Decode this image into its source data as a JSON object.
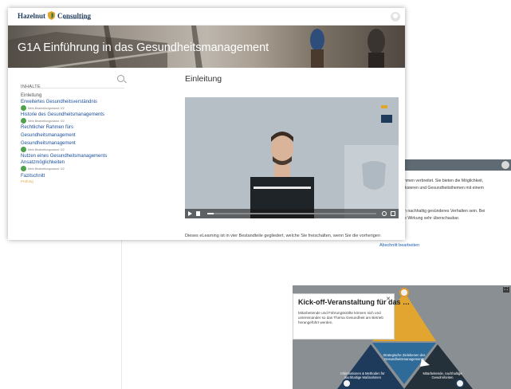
{
  "background_page": {
    "lines": [
      "nmen verbreitet. Sie bieten die Möglichkeit,",
      "iksieren und Gesundheitsthemen mit einem",
      "n nachhaltig gesünderes Verhalten sein. Bei",
      "e Wirkung sehr überschaubar."
    ],
    "edit_link": "Abschnitt bearbeiten"
  },
  "infographic": {
    "popup_title": "Kick-off-Veranstaltung für das …",
    "popup_body": "Mitarbeitende und Führungskräfte können sich und untereinander so das Thema Gesundheit am Betrieb herangeführt werden.",
    "center_label": "Strategische Zielebenen des Gesundheitsmanagements",
    "left_label": "Informationen & Methoden für nachhaltige Maßnahmen",
    "right_label": "Mitarbeitende, nachhaltige Gewohnheiten",
    "corner": "⛶",
    "colors": {
      "top": "#e2a52f",
      "center": "#2f6b99",
      "left": "#1f3b5c",
      "right": "#24303a"
    }
  },
  "card": {
    "logo_left": "Hazelnut",
    "logo_right": "Consulting",
    "logo_sub": "Gesundheits-management",
    "course_title": "G1A Einführung in das Gesundheitsmanagement",
    "sidebar": {
      "heading": "INHALTE",
      "items": [
        {
          "label": "Einleitung",
          "style": "plain"
        },
        {
          "label": "Erweitertes Gesundheitsverständnis",
          "style": "link",
          "status": "Mein Bearbeitungsstand: 0/2"
        },
        {
          "label": "Historie des Gesundheitsmanagements",
          "style": "link",
          "status": "Mein Bearbeitungsstand: 0/2"
        },
        {
          "label": "Rechtlicher Rahmen fürs",
          "style": "link"
        },
        {
          "label": "Gesundheitsmanagement",
          "style": "link"
        },
        {
          "label": "Gesundheitsmanagement",
          "style": "link",
          "status": "Mein Bearbeitungsstand: 0/2"
        },
        {
          "label": "Nutzen eines Gesundheitsmanagements",
          "style": "link"
        },
        {
          "label": "Ansatzmöglichkeiten",
          "style": "link",
          "status": "Mein Bearbeitungsstand: 0/2"
        },
        {
          "label": "Fazitschnitt",
          "style": "link",
          "sub": "Prüfung"
        }
      ]
    },
    "content_title": "Einleitung",
    "video": {
      "progress": 0.04
    },
    "content_text": "Dieses eLearning ist in vier Bestandteile gegliedert, welche Sie freischalten, wenn Sie die vorherigen Abschnitte bearbeitet haben."
  }
}
